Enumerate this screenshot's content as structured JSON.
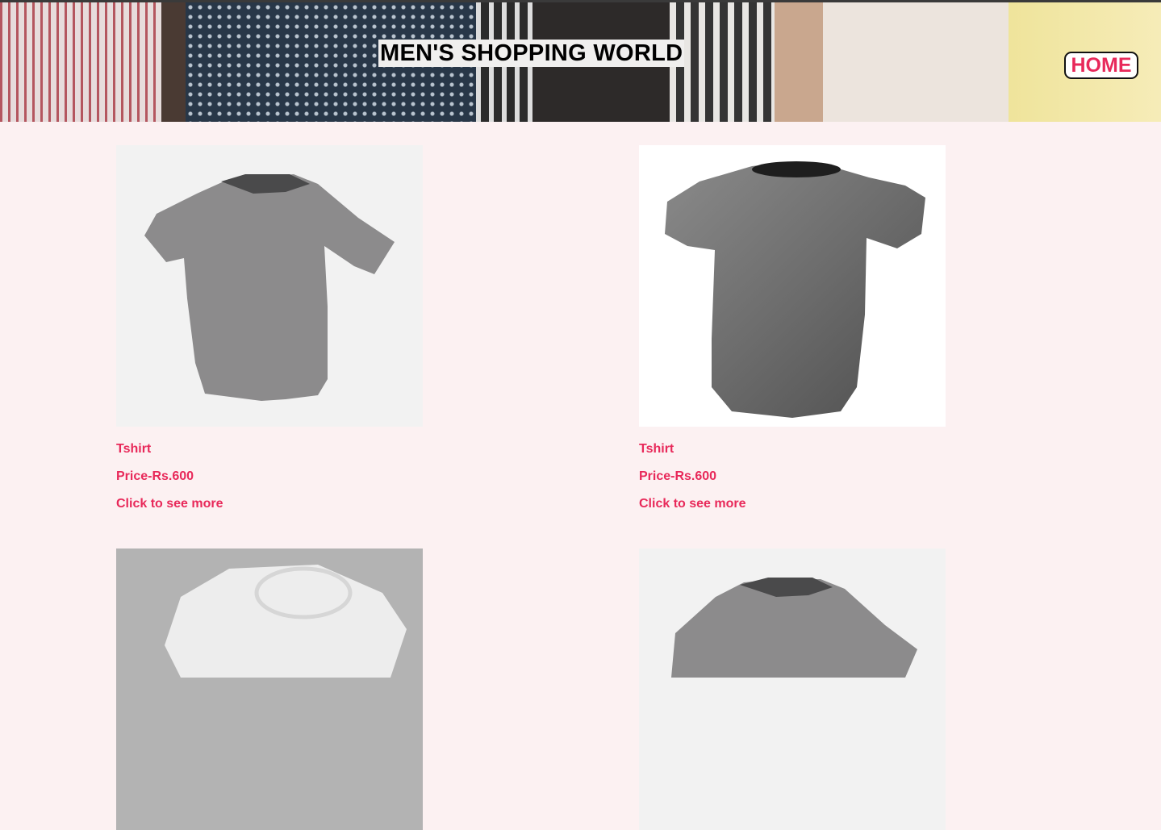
{
  "header": {
    "title": "MEN'S SHOPPING WORLD",
    "home_label": "HOME"
  },
  "colors": {
    "accent": "#e8295a",
    "page_background": "#fcf1f2"
  },
  "products": [
    {
      "name": "Tshirt",
      "price": "Price-Rs.600",
      "more": "Click to see more"
    },
    {
      "name": "Tshirt",
      "price": "Price-Rs.600",
      "more": "Click to see more"
    },
    {
      "name": "",
      "price": "",
      "more": ""
    },
    {
      "name": "",
      "price": "",
      "more": ""
    }
  ]
}
